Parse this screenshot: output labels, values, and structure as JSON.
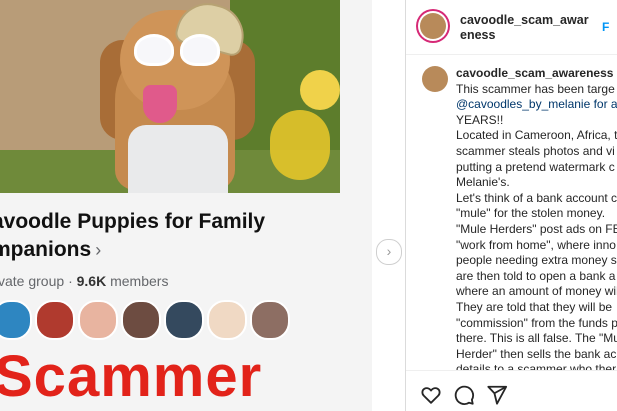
{
  "post": {
    "group_title_line1": "avoodle Puppies for Family",
    "group_title_line2": "mpanions",
    "chevron": "›",
    "privacy_label": "vate group",
    "separator": "·",
    "members_count": "9.6K",
    "members_label": "members",
    "overlay_text": "Scammer",
    "next_arrow": "›"
  },
  "panel": {
    "header_username": "cavoodle_scam_awareness",
    "follow_label": "F",
    "caption_username": "cavoodle_scam_awareness",
    "caption_lines": [
      "This scammer has been targe",
      "@cavoodles_by_melanie for al",
      "YEARS!!",
      "Located in Cameroon, Africa, t",
      "scammer steals photos and vi",
      "putting a pretend watermark c",
      "Melanie's.",
      "Let's think of a bank account c",
      "\"mule\" for the stolen money.",
      "\"Mule Herders\" post ads on FB",
      "\"work from home\", where inno",
      "people needing extra money s",
      "are then told to open a bank a",
      "where an amount of money wil",
      "They are told that they will be",
      "\"commission\" from the funds p",
      "there. This is all false. The \"Mu",
      "Herder\" then sells the bank ac",
      "details to a scammer who ther"
    ],
    "mention_text": "@cavoodles_by_melanie"
  },
  "icons": {
    "like": "heart-icon",
    "comment": "comment-icon",
    "share": "send-icon"
  },
  "colors": {
    "instagram_blue": "#0095f6",
    "scam_red": "#e2231a",
    "story_ring": "#d62976"
  }
}
